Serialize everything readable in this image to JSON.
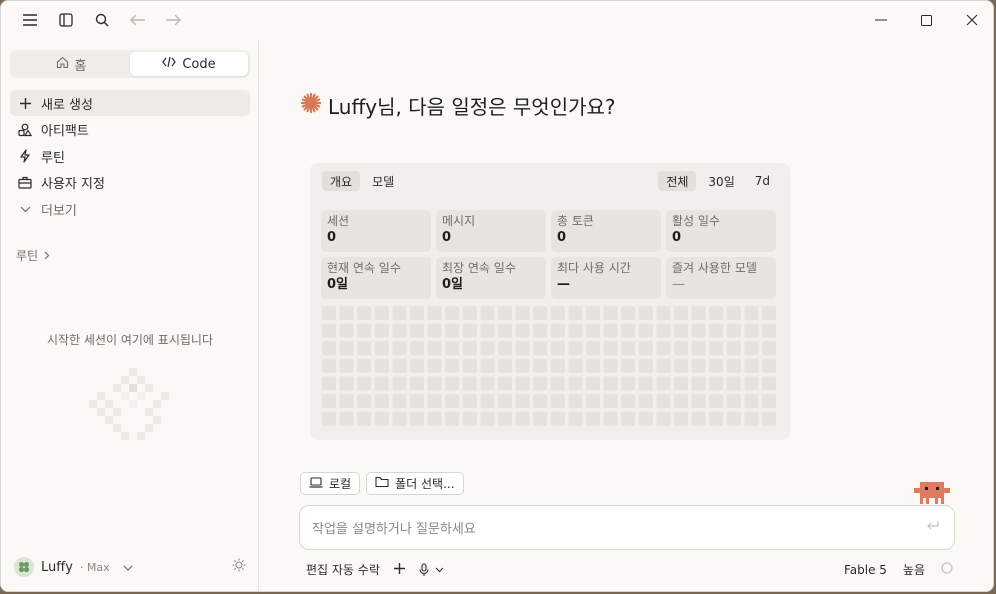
{
  "colors": {
    "accent": "#d97757",
    "mascot": "#e07a5f",
    "avatar": "#6f9a6a"
  },
  "sidebar": {
    "tabs": [
      {
        "label": "홈",
        "icon": "home-icon"
      },
      {
        "label": "Code",
        "icon": "code-icon"
      }
    ],
    "items": [
      {
        "label": "새로 생성",
        "icon": "plus-icon"
      },
      {
        "label": "아티팩트",
        "icon": "artifact-icon"
      },
      {
        "label": "루틴",
        "icon": "lightning-icon"
      },
      {
        "label": "사용자 지정",
        "icon": "briefcase-icon"
      },
      {
        "label": "더보기",
        "icon": "chevron-down-icon"
      }
    ],
    "section_title": "루틴",
    "empty_text": "시작한 세션이 여기에 표시됩니다",
    "user": {
      "name": "Luffy",
      "plan": "· Max"
    }
  },
  "main": {
    "greeting": "Luffy님, 다음 일정은 무엇인가요?",
    "stats": {
      "tabs_left": [
        "개요",
        "모델"
      ],
      "tabs_right": [
        "전체",
        "30일",
        "7d"
      ],
      "cards": [
        {
          "label": "세션",
          "value": "0"
        },
        {
          "label": "메시지",
          "value": "0"
        },
        {
          "label": "총 토큰",
          "value": "0"
        },
        {
          "label": "활성 일수",
          "value": "0"
        },
        {
          "label": "현재 연속 일수",
          "value": "0일"
        },
        {
          "label": "최장 연속 일수",
          "value": "0일"
        },
        {
          "label": "최다 사용 시간",
          "value": "—"
        },
        {
          "label": "즐겨 사용한 모델",
          "value": "—"
        }
      ]
    },
    "chips": [
      {
        "label": "로컬",
        "icon": "laptop-icon"
      },
      {
        "label": "폴더 선택...",
        "icon": "folder-icon"
      }
    ],
    "prompt_placeholder": "작업을 설명하거나 질문하세요",
    "bottom": {
      "auto_accept": "편집 자동 수락",
      "model": "Fable 5",
      "effort": "높음"
    }
  }
}
